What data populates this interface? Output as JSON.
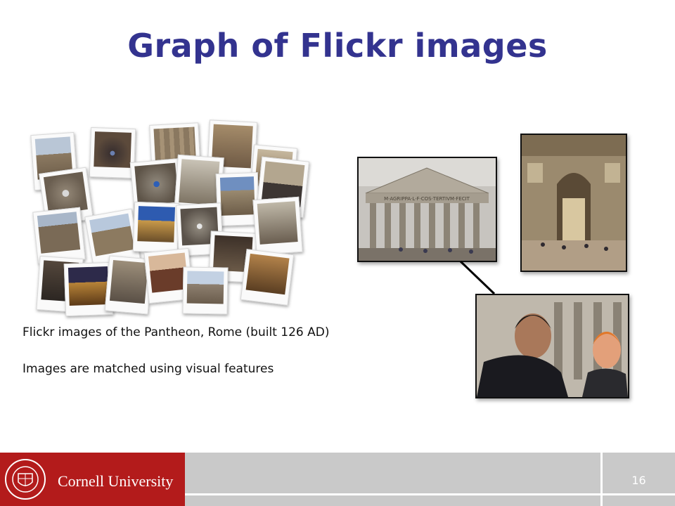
{
  "slide": {
    "title": "Graph of Flickr images",
    "captions": [
      "Flickr images of the Pantheon, Rome (built 126 AD)",
      "Images are matched using visual features"
    ],
    "inscription": "M·AGRIPPA·L·F·COS·TERTIVM·FECIT",
    "colors": {
      "title": "#33338f",
      "footer_red": "#b31b1b",
      "footer_gray": "#c9c9c9"
    }
  },
  "footer": {
    "university": "Cornell University",
    "page_number": "16",
    "seal_icon": "cornell-seal-icon",
    "seal_text": "CORNELL UNIVERSITY FOUNDED A.D. 1865"
  }
}
